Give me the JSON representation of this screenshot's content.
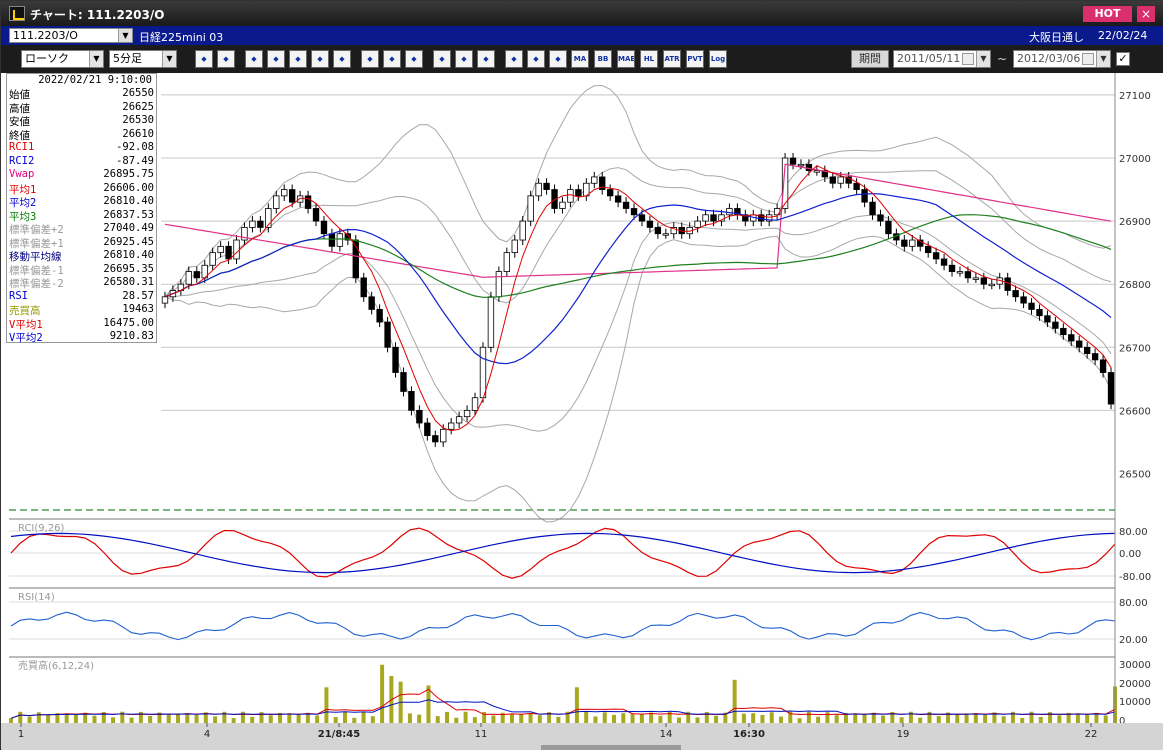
{
  "window": {
    "title": "チャート: 111.2203/O",
    "hot_label": "HOT",
    "close_label": "×"
  },
  "symbol_bar": {
    "symbol": "111.2203/O",
    "name": "日経225mini 03",
    "session": "大阪日通し",
    "date": "22/02/24"
  },
  "toolbar": {
    "chart_type": "ローソク",
    "interval": "5分足",
    "period_button": "期間",
    "date_from": "2011/05/11",
    "date_to": "2012/03/06",
    "tilde": "~",
    "buttons": [
      "magnifier-icon",
      "bars-icon",
      "cursor-icon",
      "search-plus-icon",
      "table-icon",
      "candle-icon",
      "warning-icon",
      "pen-icon",
      "arrow-icon",
      "undo-icon",
      "bar-icon",
      "bar2-icon",
      "all-icon",
      "grid-icon",
      "tool-icon",
      "color-icon"
    ],
    "indicator_buttons": [
      "MA",
      "BB",
      "MAE",
      "HL",
      "ATR",
      "PVT",
      "Log"
    ]
  },
  "info_panel": {
    "timestamp": "2022/02/21  9:10:00",
    "rows": [
      {
        "label": "始値",
        "value": "26550",
        "color": "#000000"
      },
      {
        "label": "高値",
        "value": "26625",
        "color": "#000000"
      },
      {
        "label": "安値",
        "value": "26530",
        "color": "#000000"
      },
      {
        "label": "終値",
        "value": "26610",
        "color": "#000000"
      },
      {
        "label": "RCI1",
        "value": "-92.08",
        "color": "#e00000"
      },
      {
        "label": "RCI2",
        "value": "-87.49",
        "color": "#0000d0"
      },
      {
        "label": "Vwap",
        "value": "26895.75",
        "color": "#e0007a"
      },
      {
        "label": "平均1",
        "value": "26606.00",
        "color": "#e00000"
      },
      {
        "label": "平均2",
        "value": "26810.40",
        "color": "#0000d0"
      },
      {
        "label": "平均3",
        "value": "26837.53",
        "color": "#008000"
      },
      {
        "label": "標準偏差+2",
        "value": "27040.49",
        "color": "#999999"
      },
      {
        "label": "標準偏差+1",
        "value": "26925.45",
        "color": "#999999"
      },
      {
        "label": "移動平均線",
        "value": "26810.40",
        "color": "#000080"
      },
      {
        "label": "標準偏差-1",
        "value": "26695.35",
        "color": "#999999"
      },
      {
        "label": "標準偏差-2",
        "value": "26580.31",
        "color": "#999999"
      },
      {
        "label": "RSI",
        "value": "28.57",
        "color": "#0000d0"
      },
      {
        "label": "売買高",
        "value": "19463",
        "color": "#9a9a00"
      },
      {
        "label": "V平均1",
        "value": "16475.00",
        "color": "#e00000"
      },
      {
        "label": "V平均2",
        "value": "9210.83",
        "color": "#0000d0"
      }
    ]
  },
  "panes": {
    "rci_label": "RCI(9,26)",
    "rsi_label": "RSI(14)",
    "vol_label": "売買高(6,12,24)"
  },
  "axes": {
    "price_ticks": [
      "27100",
      "27000",
      "26900",
      "26800",
      "26700",
      "26600",
      "26500"
    ],
    "rci_ticks": [
      "80.00",
      "0.00",
      "-80.00"
    ],
    "rsi_ticks": [
      "80.00",
      "20.00"
    ],
    "vol_ticks": [
      "30000",
      "20000",
      "10000",
      "0"
    ],
    "time_labels": [
      "1",
      "4",
      "21/8:45",
      "11",
      "14",
      "16:30",
      "19",
      "22"
    ]
  },
  "colors": {
    "price_up": "#ffffff",
    "price_down": "#000000",
    "ma1": "#e00000",
    "ma2": "#1020d0",
    "ma3": "#208020",
    "vwap": "#e0308a",
    "bb": "#999999",
    "volume": "#a8a820"
  },
  "chart_data": {
    "type": "candlestick",
    "price_range": [
      26450,
      27130
    ],
    "current_level": 26610,
    "closes": [
      26780,
      26790,
      26800,
      26820,
      26810,
      26830,
      26850,
      26860,
      26840,
      26870,
      26890,
      26900,
      26890,
      26920,
      26940,
      26950,
      26930,
      26940,
      26920,
      26900,
      26880,
      26860,
      26880,
      26870,
      26810,
      26780,
      26760,
      26740,
      26700,
      26660,
      26630,
      26600,
      26580,
      26560,
      26550,
      26570,
      26580,
      26590,
      26600,
      26620,
      26700,
      26780,
      26820,
      26850,
      26870,
      26900,
      26940,
      26960,
      26950,
      26920,
      26930,
      26950,
      26940,
      26960,
      26970,
      26950,
      26940,
      26930,
      26920,
      26910,
      26900,
      26890,
      26880,
      26880,
      26890,
      26880,
      26890,
      26900,
      26910,
      26900,
      26910,
      26920,
      26910,
      26900,
      26910,
      26900,
      26910,
      26920,
      27000,
      26990,
      26990,
      26980,
      26980,
      26970,
      26960,
      26970,
      26960,
      26950,
      26930,
      26910,
      26900,
      26880,
      26870,
      26860,
      26870,
      26860,
      26850,
      26840,
      26830,
      26820,
      26820,
      26810,
      26810,
      26800,
      26800,
      26810,
      26790,
      26780,
      26770,
      26760,
      26750,
      26740,
      26730,
      26720,
      26710,
      26700,
      26690,
      26680,
      26660,
      26610
    ],
    "vol_highlights": [
      {
        "bar": 34,
        "volume": 19000
      },
      {
        "bar": 40,
        "volume": 31000
      },
      {
        "bar": 41,
        "volume": 25000
      },
      {
        "bar": 42,
        "volume": 22000
      },
      {
        "bar": 45,
        "volume": 20000
      },
      {
        "bar": 61,
        "volume": 19000
      },
      {
        "bar": 78,
        "volume": 23000
      },
      {
        "bar": 119,
        "volume": 19463
      }
    ]
  }
}
